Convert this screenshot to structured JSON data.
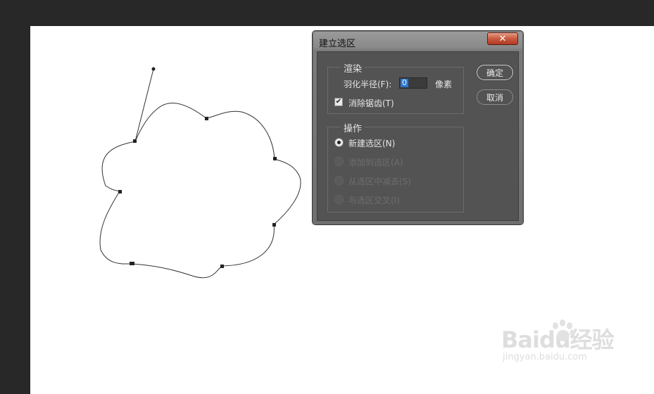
{
  "dialog": {
    "title": "建立选区",
    "close_label": "✕",
    "render": {
      "legend": "渲染",
      "feather_label": "羽化半径(F):",
      "feather_value": "0",
      "feather_unit": "像素",
      "antialias_label": "消除锯齿(T)",
      "antialias_checked": true
    },
    "operation": {
      "legend": "操作",
      "options": [
        {
          "label": "新建选区(N)",
          "selected": true,
          "enabled": true
        },
        {
          "label": "添加到选区(A)",
          "selected": false,
          "enabled": false
        },
        {
          "label": "从选区中减去(S)",
          "selected": false,
          "enabled": false
        },
        {
          "label": "与选区交叉(I)",
          "selected": false,
          "enabled": false
        }
      ]
    },
    "ok_label": "确定",
    "cancel_label": "取消"
  },
  "watermark": {
    "main": "Baidu经验",
    "sub": "jingyan.baidu.com"
  }
}
